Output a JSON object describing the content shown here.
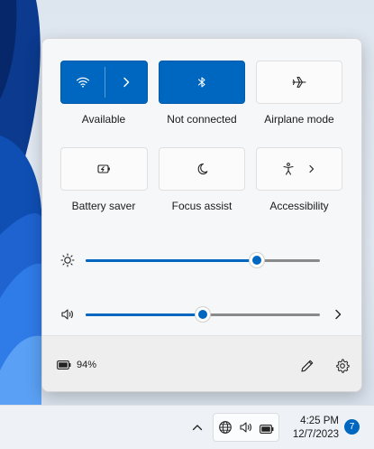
{
  "quick_settings": {
    "tiles": [
      {
        "label": "Available",
        "icon": "wifi-icon",
        "state": "on",
        "has_chevron": true
      },
      {
        "label": "Not connected",
        "icon": "bluetooth-icon",
        "state": "on"
      },
      {
        "label": "Airplane mode",
        "icon": "airplane-icon",
        "state": "off"
      },
      {
        "label": "Battery saver",
        "icon": "battery-saver-icon",
        "state": "off"
      },
      {
        "label": "Focus assist",
        "icon": "moon-icon",
        "state": "off"
      },
      {
        "label": "Accessibility",
        "icon": "accessibility-icon",
        "state": "off",
        "has_chevron": true
      }
    ],
    "brightness": {
      "icon": "brightness-icon",
      "value_percent": 73
    },
    "volume": {
      "icon": "speaker-icon",
      "value_percent": 50
    }
  },
  "footer": {
    "battery_text": "94%",
    "battery_icon": "battery-icon",
    "edit_icon": "pencil-icon",
    "settings_icon": "gear-icon"
  },
  "taskbar": {
    "time": "4:25 PM",
    "date": "12/7/2023",
    "notification_count": "7",
    "tray_icons": [
      "globe-icon",
      "speaker-icon",
      "battery-icon"
    ]
  },
  "colors": {
    "accent": "#0067c0",
    "panel": "#f3f3f3"
  }
}
